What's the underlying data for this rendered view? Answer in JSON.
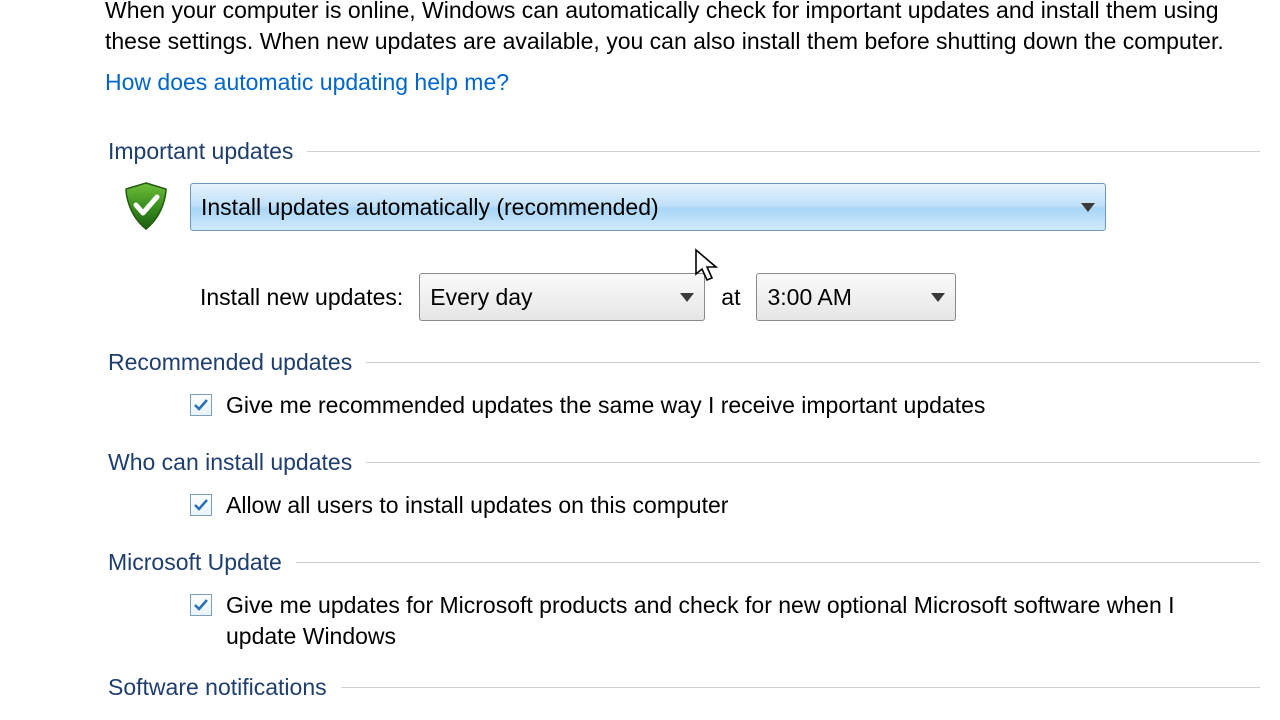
{
  "intro": "When your computer is online, Windows can automatically check for important updates and install them using these settings. When new updates are available, you can also install them before shutting down the computer.",
  "help_link": "How does automatic updating help me?",
  "sections": {
    "important": {
      "legend": "Important updates",
      "main_selection": "Install updates automatically (recommended)",
      "schedule_label": "Install new updates:",
      "frequency": "Every day",
      "at_label": "at",
      "time": "3:00 AM"
    },
    "recommended": {
      "legend": "Recommended updates",
      "checkbox_label": "Give me recommended updates the same way I receive important updates",
      "checked": true
    },
    "who": {
      "legend": "Who can install updates",
      "checkbox_label": "Allow all users to install updates on this computer",
      "checked": true
    },
    "ms_update": {
      "legend": "Microsoft Update",
      "checkbox_label": "Give me updates for Microsoft products and check for new optional Microsoft software when I update Windows",
      "checked": true
    },
    "software_notif": {
      "legend": "Software notifications"
    }
  }
}
